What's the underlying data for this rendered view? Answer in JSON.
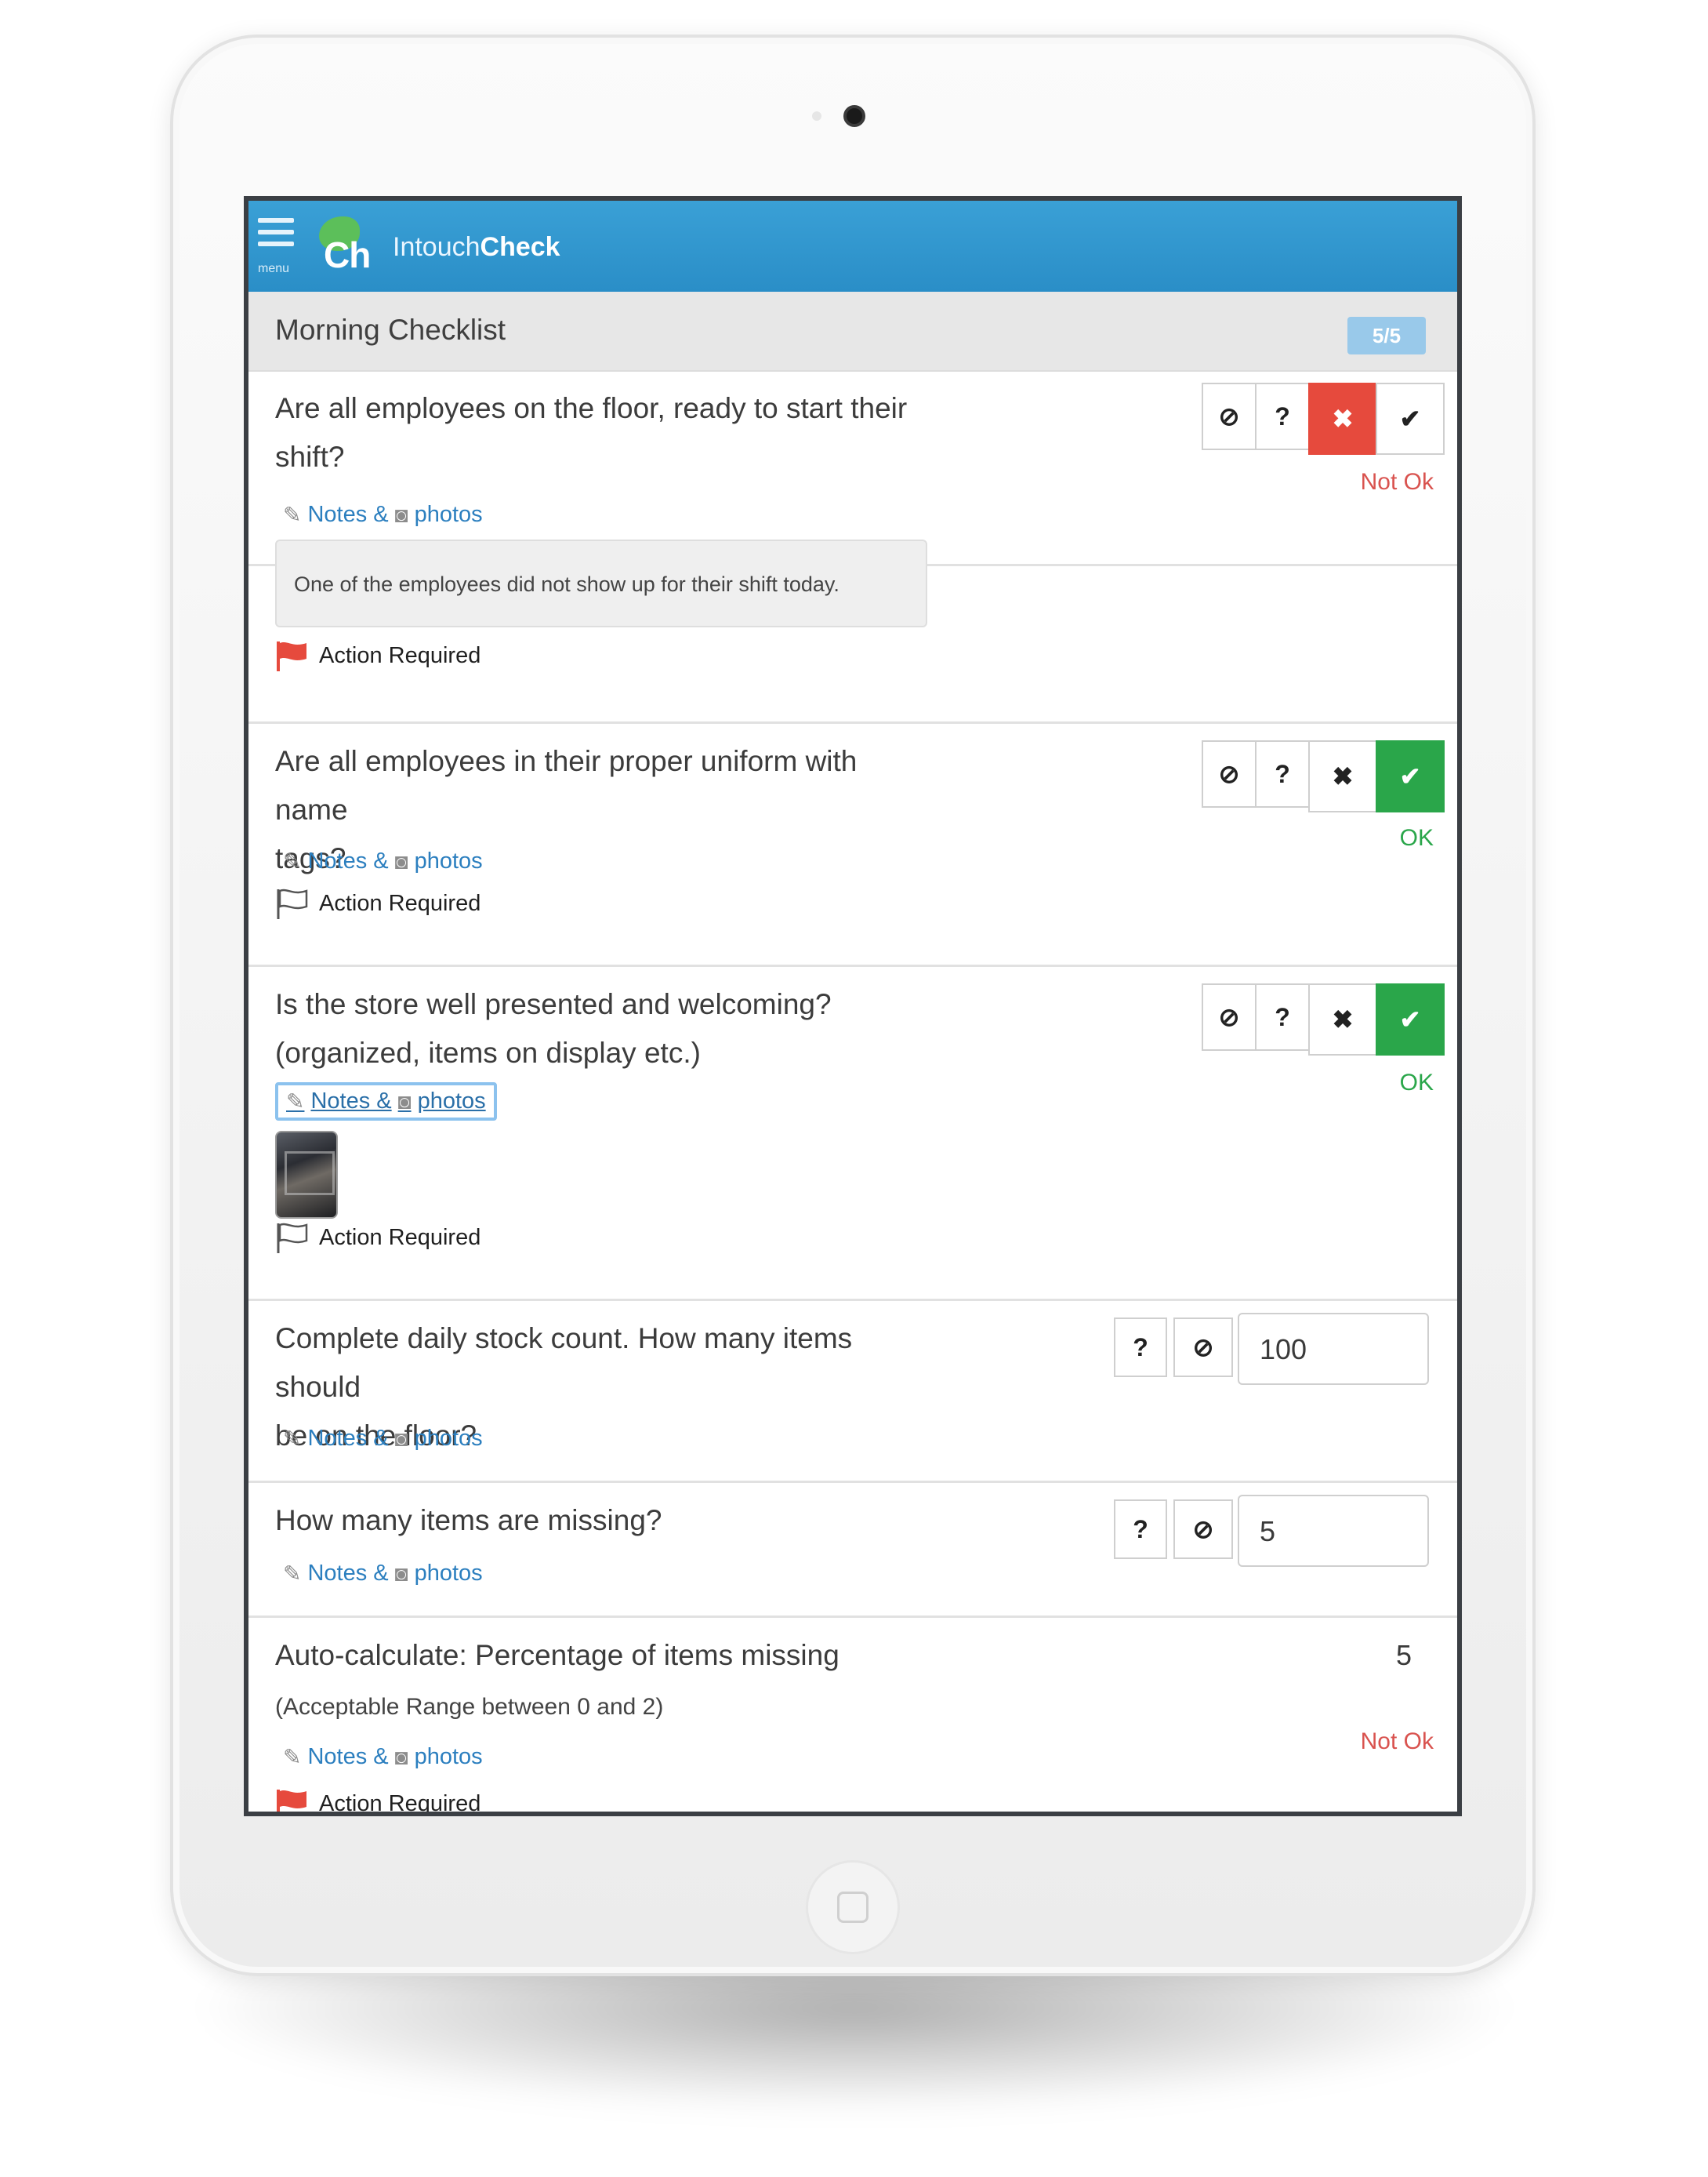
{
  "app": {
    "menu_label": "menu",
    "logo_text": "Ch",
    "brand_light": "Intouch",
    "brand_bold": "Check"
  },
  "checklist": {
    "title": "Morning Checklist",
    "progress": "5/5"
  },
  "common": {
    "notes_label": "Notes &",
    "photos_label": "photos",
    "action_required": "Action Required"
  },
  "items": [
    {
      "question_line1": "Are all employees on the floor, ready to start their",
      "question_line2": "shift?",
      "note_text": "One of the employees did not show up for their shift today.",
      "status": "Not Ok",
      "selected": "not-ok",
      "flagged": true
    },
    {
      "question_line1": "Are all employees in their proper uniform with name",
      "question_line2": "tags?",
      "status": "OK",
      "selected": "ok",
      "flagged": false
    },
    {
      "question_line1": "Is the store well presented and welcoming?",
      "question_line2": "(organized, items on display etc.)",
      "status": "OK",
      "selected": "ok",
      "flagged": false,
      "has_photo": true
    },
    {
      "question_line1": "Complete daily stock count. How many items should",
      "question_line2": "be on the floor?",
      "value": "100"
    },
    {
      "question_line1": "How many items are missing?",
      "value": "5"
    },
    {
      "question_line1": "Auto-calculate: Percentage of items missing",
      "range_text": "(Acceptable Range between 0 and 2)",
      "value": "5",
      "status": "Not Ok",
      "flagged": true
    }
  ],
  "buttons": {
    "na": "⊘",
    "unsure": "?",
    "not_ok": "✖",
    "ok": "✔"
  },
  "colors": {
    "header": "#2a8ec7",
    "not_ok": "#e64a3d",
    "ok": "#2aa64a",
    "link": "#2c7fbf",
    "badge": "#99c9ea"
  },
  "icons": [
    "menu-icon",
    "na-icon",
    "question-icon",
    "x-icon",
    "check-icon",
    "edit-icon",
    "camera-icon",
    "flag-icon"
  ]
}
